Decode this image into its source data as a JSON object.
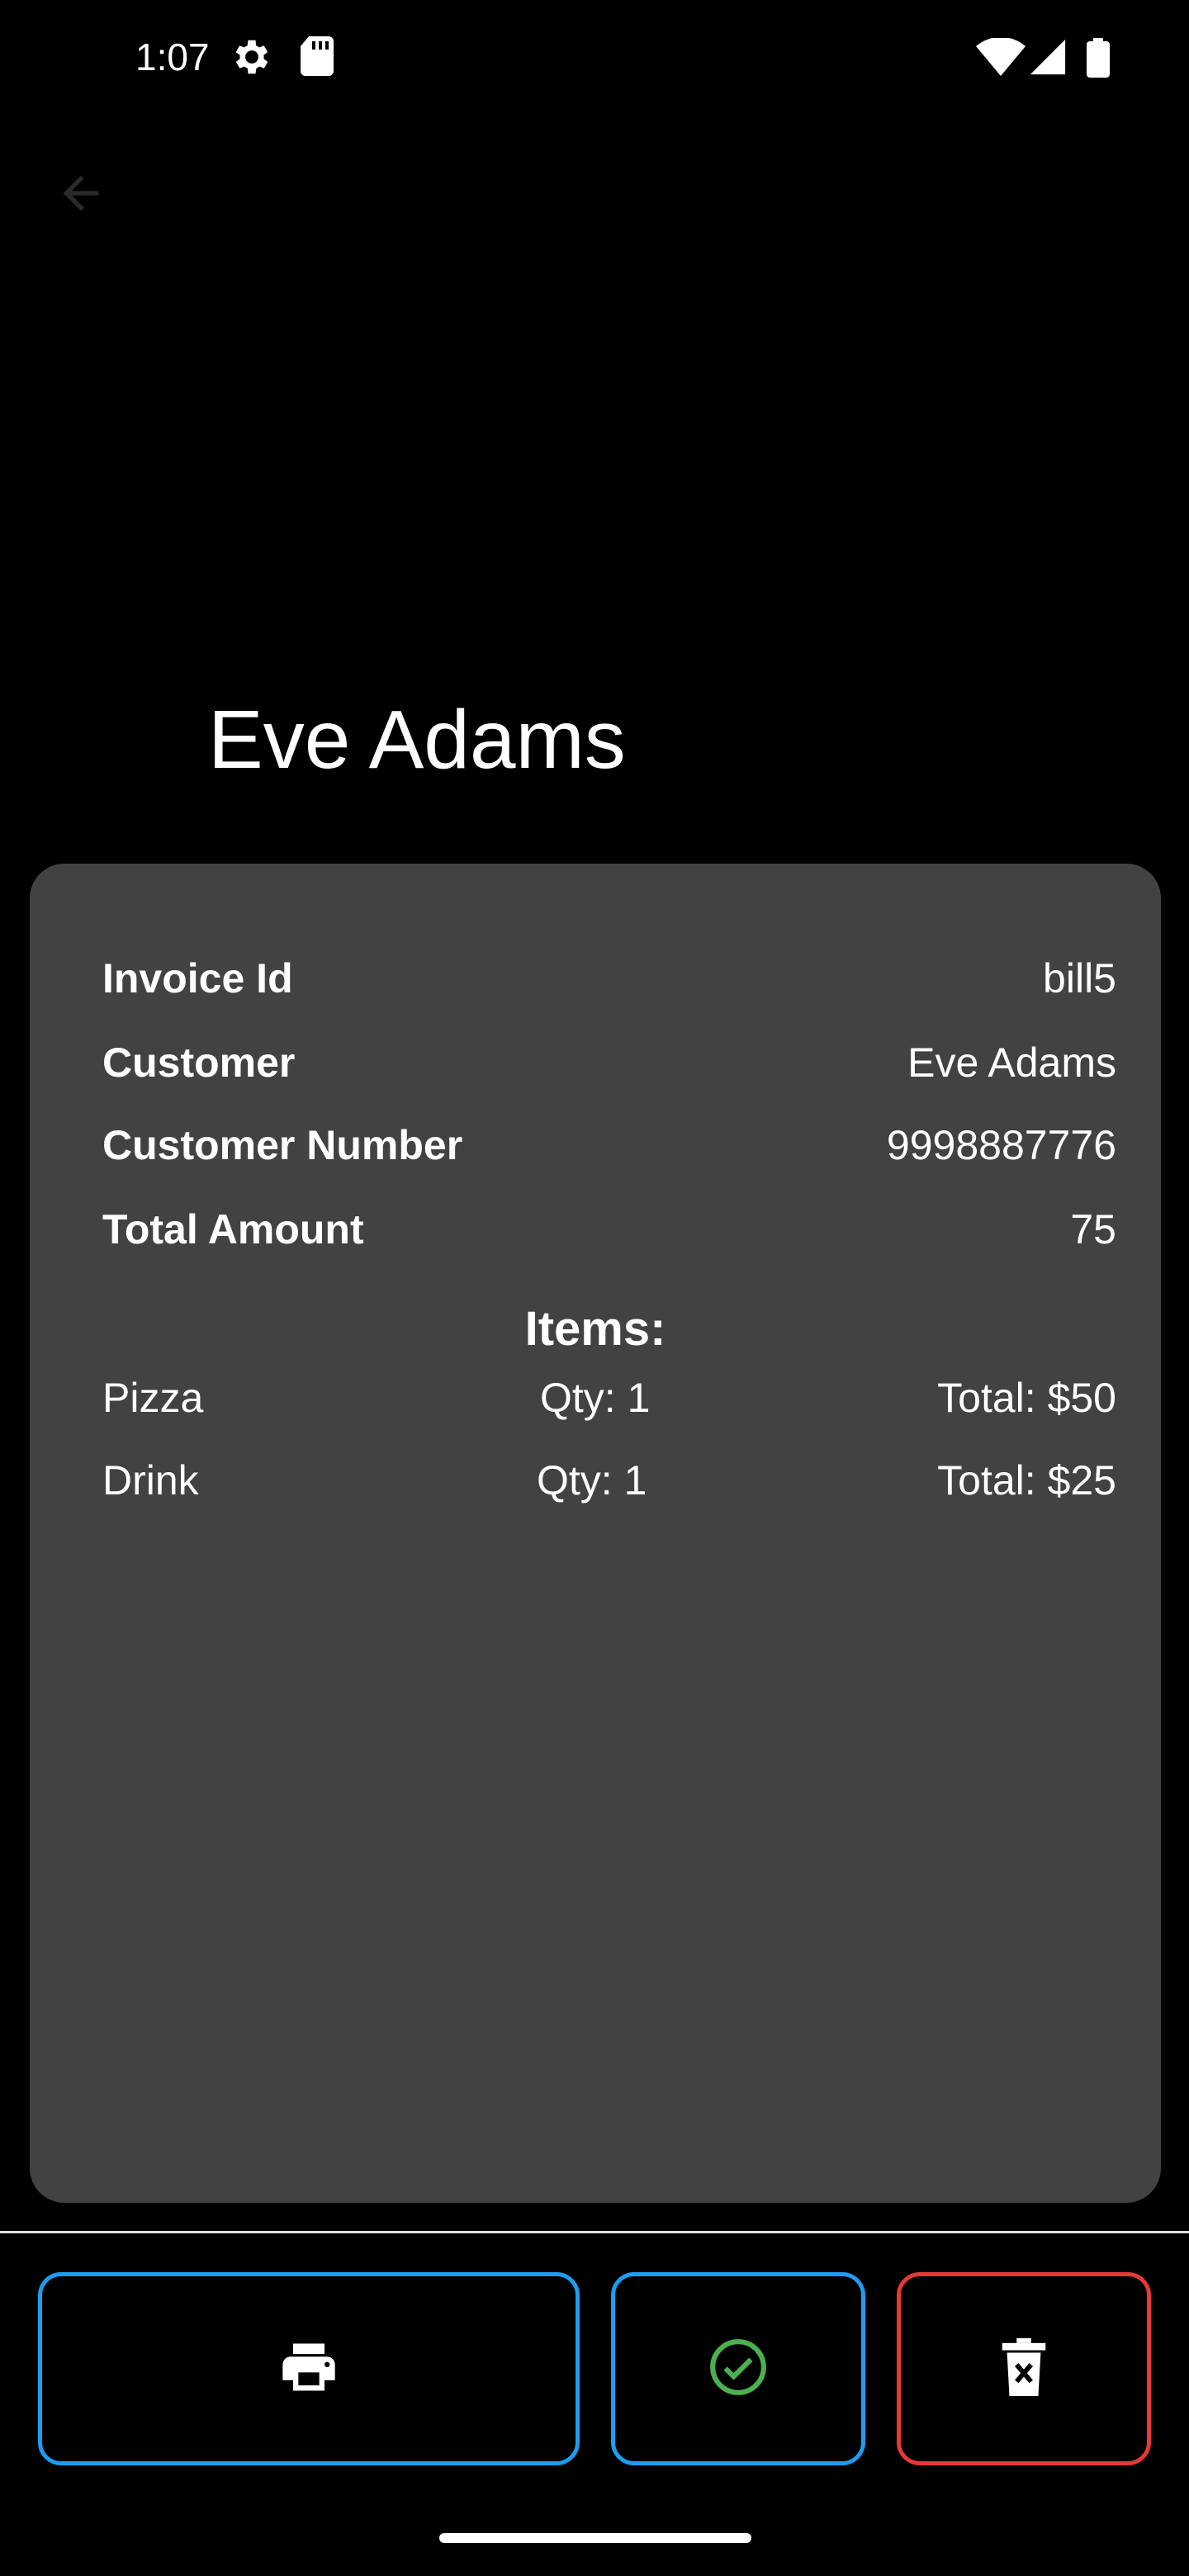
{
  "status_bar": {
    "time": "1:07",
    "icons": [
      "gear-icon",
      "sd-card-icon",
      "wifi-icon",
      "signal-icon",
      "battery-icon"
    ]
  },
  "app_bar": {
    "back_icon": "arrow-back-icon"
  },
  "header": {
    "title": "Eve Adams"
  },
  "invoice": {
    "details": [
      {
        "label": "Invoice Id",
        "value": "bill5"
      },
      {
        "label": "Customer",
        "value": "Eve Adams"
      },
      {
        "label": "Customer Number",
        "value": "9998887776"
      },
      {
        "label": "Total Amount",
        "value": "75"
      }
    ],
    "items_heading": "Items:",
    "items": [
      {
        "name": "Pizza",
        "qty": "Qty: 1",
        "total": "Total: $50"
      },
      {
        "name": "Drink",
        "qty": "Qty: 1",
        "total": "Total: $25"
      }
    ]
  },
  "actions": {
    "print_icon": "printer-icon",
    "confirm_icon": "check-circle-icon",
    "delete_icon": "delete-icon"
  },
  "colors": {
    "background": "#000000",
    "card": "#424242",
    "primary_border": "#1e9cf0",
    "danger_border": "#e53935",
    "success": "#4caf50"
  }
}
